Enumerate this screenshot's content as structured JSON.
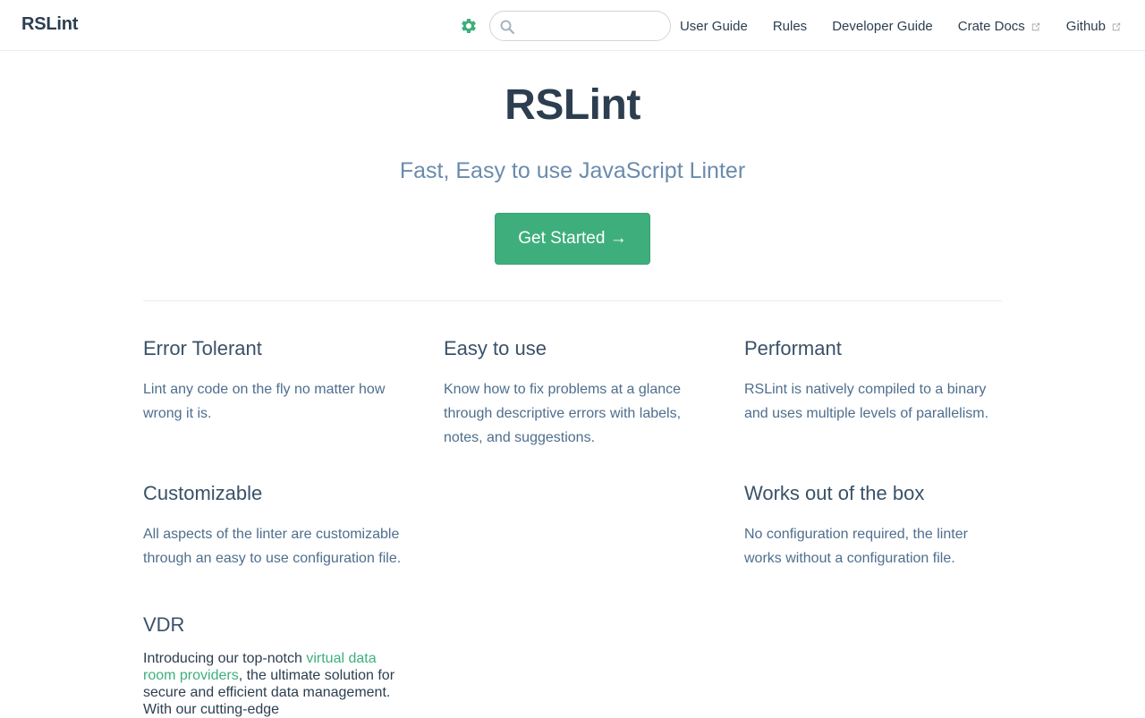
{
  "navbar": {
    "site_name": "RSLint",
    "search": {
      "placeholder": "",
      "value": ""
    },
    "links": [
      {
        "label": "User Guide",
        "external": false
      },
      {
        "label": "Rules",
        "external": false
      },
      {
        "label": "Developer Guide",
        "external": false
      },
      {
        "label": "Crate Docs",
        "external": true
      },
      {
        "label": "Github",
        "external": true
      }
    ]
  },
  "hero": {
    "title": "RSLint",
    "tagline": "Fast, Easy to use JavaScript Linter",
    "cta_label": "Get Started →"
  },
  "features": [
    {
      "title": "Error Tolerant",
      "details": "Lint any code on the fly no matter how wrong it is."
    },
    {
      "title": "Easy to use",
      "details": "Know how to fix problems at a glance through descriptive errors with labels, notes, and suggestions."
    },
    {
      "title": "Performant",
      "details": "RSLint is natively compiled to a binary and uses multiple levels of parallelism."
    },
    {
      "title": "Customizable",
      "details": "All aspects of the linter are customizable through an easy to use configuration file."
    },
    {
      "title": "Works out of the box",
      "details": "No configuration required, the linter works without a configuration file."
    }
  ],
  "vdr": {
    "title": "VDR",
    "text_before": "Introducing our top-notch ",
    "link_text": "virtual data room providers",
    "text_after": ", the ultimate solution for secure and efficient data management. With our cutting-edge"
  },
  "colors": {
    "accent": "#3eaf7c",
    "text": "#2c3e50",
    "tagline": "#6a8bad",
    "border": "#eaecef"
  },
  "icons": {
    "settings": "gear-icon",
    "search": "search-icon",
    "external": "external-link-icon"
  }
}
